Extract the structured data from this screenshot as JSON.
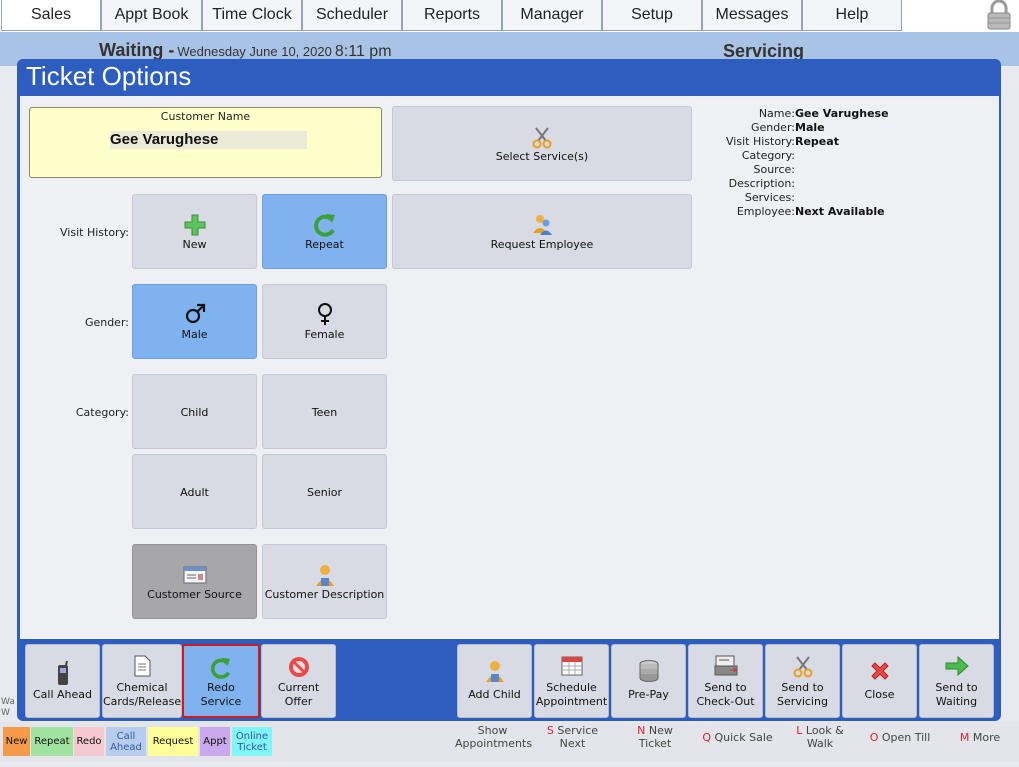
{
  "nav": {
    "tabs": [
      "Sales",
      "Appt Book",
      "Time Clock",
      "Scheduler",
      "Reports",
      "Manager",
      "Setup",
      "Messages",
      "Help"
    ],
    "active": "Sales"
  },
  "status": {
    "waiting": "Waiting -",
    "date": "Wednesday June 10, 2020",
    "time": "8:11 pm",
    "servicing": "Servicing"
  },
  "dialog": {
    "title": "Ticket Options",
    "customer_label": "Customer Name",
    "customer_name": "Gee Varughese",
    "select_services": "Select Service(s)",
    "request_employee": "Request Employee",
    "visit_history_label": "Visit History:",
    "gender_label": "Gender:",
    "category_label": "Category:",
    "visit_new": "New",
    "visit_repeat": "Repeat",
    "gender_male": "Male",
    "gender_female": "Female",
    "cat_child": "Child",
    "cat_teen": "Teen",
    "cat_adult": "Adult",
    "cat_senior": "Senior",
    "customer_source": "Customer Source",
    "customer_description": "Customer Description"
  },
  "info": {
    "name_k": "Name:",
    "name_v": "Gee Varughese",
    "gender_k": "Gender:",
    "gender_v": "Male",
    "visit_k": "Visit History:",
    "visit_v": "Repeat",
    "category_k": "Category:",
    "category_v": "",
    "source_k": "Source:",
    "source_v": "",
    "description_k": "Description:",
    "description_v": "",
    "services_k": "Services:",
    "services_v": "",
    "employee_k": "Employee:",
    "employee_v": "Next Available"
  },
  "toolbar": {
    "call_ahead": "Call Ahead",
    "chemical_1": "Chemical",
    "chemical_2": "Cards/Release",
    "redo_1": "Redo",
    "redo_2": "Service",
    "offer_1": "Current",
    "offer_2": "Offer",
    "add_child": "Add Child",
    "schedule_1": "Schedule",
    "schedule_2": "Appointment",
    "prepay": "Pre-Pay",
    "checkout_1": "Send to",
    "checkout_2": "Check-Out",
    "servicing_1": "Send to",
    "servicing_2": "Servicing",
    "close": "Close",
    "waiting_1": "Send to",
    "waiting_2": "Waiting"
  },
  "legend": {
    "new": "New",
    "repeat": "Repeat",
    "redo": "Redo",
    "call_1": "Call",
    "call_2": "Ahead",
    "request": "Request",
    "appt": "Appt",
    "online_1": "Online",
    "online_2": "Ticket"
  },
  "under": {
    "clip_1": "Wa",
    "clip_2": "W",
    "show_1": "Show",
    "show_2": "Appointments",
    "service_key": "S",
    "service_1": "Service",
    "service_2": "Next",
    "newt_key": "N",
    "newt_1": "New",
    "newt_2": "Ticket",
    "quick_key": "Q",
    "quick": "Quick Sale",
    "look_key": "L",
    "look_1": "Look &",
    "look_2": "Walk",
    "till_key": "O",
    "till": "Open Till",
    "more_key": "M",
    "more": "More"
  },
  "colors": {
    "dialog_blue": "#2d5dbf",
    "selected_blue": "#7fb2ef",
    "customer_yellow": "#ffffcc",
    "highlight_red": "#d11a1a"
  }
}
